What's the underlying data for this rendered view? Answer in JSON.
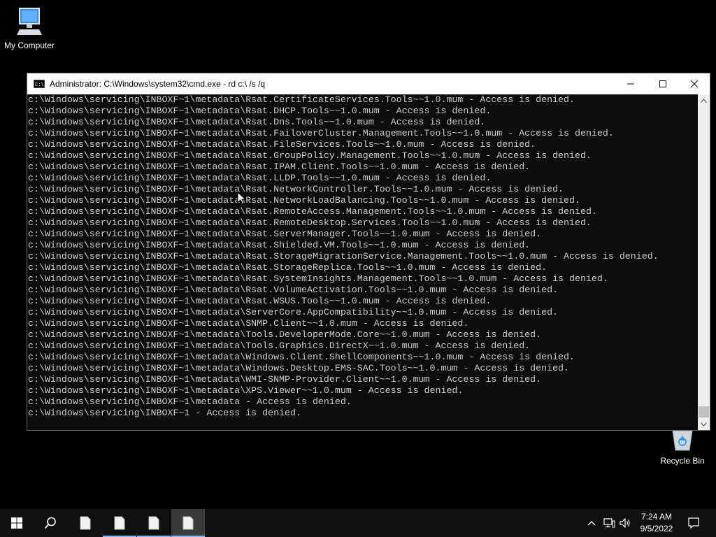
{
  "desktop": {
    "icons": [
      {
        "label": "My Computer",
        "icon": "computer-icon"
      },
      {
        "label": "Recycle Bin",
        "icon": "recycle-bin-icon"
      }
    ]
  },
  "window": {
    "title": "Administrator: C:\\Windows\\system32\\cmd.exe - rd  c:\\ /s /q",
    "app_icon": "cmd-icon",
    "controls": [
      "minimize-icon",
      "maximize-icon",
      "close-icon"
    ]
  },
  "console": {
    "lines": [
      "c:\\Windows\\servicing\\INBOXF~1\\metadata\\Rsat.CertificateServices.Tools~~1.0.mum - Access is denied.",
      "c:\\Windows\\servicing\\INBOXF~1\\metadata\\Rsat.DHCP.Tools~~1.0.mum - Access is denied.",
      "c:\\Windows\\servicing\\INBOXF~1\\metadata\\Rsat.Dns.Tools~~1.0.mum - Access is denied.",
      "c:\\Windows\\servicing\\INBOXF~1\\metadata\\Rsat.FailoverCluster.Management.Tools~~1.0.mum - Access is denied.",
      "c:\\Windows\\servicing\\INBOXF~1\\metadata\\Rsat.FileServices.Tools~~1.0.mum - Access is denied.",
      "c:\\Windows\\servicing\\INBOXF~1\\metadata\\Rsat.GroupPolicy.Management.Tools~~1.0.mum - Access is denied.",
      "c:\\Windows\\servicing\\INBOXF~1\\metadata\\Rsat.IPAM.Client.Tools~~1.0.mum - Access is denied.",
      "c:\\Windows\\servicing\\INBOXF~1\\metadata\\Rsat.LLDP.Tools~~1.0.mum - Access is denied.",
      "c:\\Windows\\servicing\\INBOXF~1\\metadata\\Rsat.NetworkController.Tools~~1.0.mum - Access is denied.",
      "c:\\Windows\\servicing\\INBOXF~1\\metadata\\Rsat.NetworkLoadBalancing.Tools~~1.0.mum - Access is denied.",
      "c:\\Windows\\servicing\\INBOXF~1\\metadata\\Rsat.RemoteAccess.Management.Tools~~1.0.mum - Access is denied.",
      "c:\\Windows\\servicing\\INBOXF~1\\metadata\\Rsat.RemoteDesktop.Services.Tools~~1.0.mum - Access is denied.",
      "c:\\Windows\\servicing\\INBOXF~1\\metadata\\Rsat.ServerManager.Tools~~1.0.mum - Access is denied.",
      "c:\\Windows\\servicing\\INBOXF~1\\metadata\\Rsat.Shielded.VM.Tools~~1.0.mum - Access is denied.",
      "c:\\Windows\\servicing\\INBOXF~1\\metadata\\Rsat.StorageMigrationService.Management.Tools~~1.0.mum - Access is denied.",
      "c:\\Windows\\servicing\\INBOXF~1\\metadata\\Rsat.StorageReplica.Tools~~1.0.mum - Access is denied.",
      "c:\\Windows\\servicing\\INBOXF~1\\metadata\\Rsat.SystemInsights.Management.Tools~~1.0.mum - Access is denied.",
      "c:\\Windows\\servicing\\INBOXF~1\\metadata\\Rsat.VolumeActivation.Tools~~1.0.mum - Access is denied.",
      "c:\\Windows\\servicing\\INBOXF~1\\metadata\\Rsat.WSUS.Tools~~1.0.mum - Access is denied.",
      "c:\\Windows\\servicing\\INBOXF~1\\metadata\\ServerCore.AppCompatibility~~1.0.mum - Access is denied.",
      "c:\\Windows\\servicing\\INBOXF~1\\metadata\\SNMP.Client~~1.0.mum - Access is denied.",
      "c:\\Windows\\servicing\\INBOXF~1\\metadata\\Tools.DeveloperMode.Core~~1.0.mum - Access is denied.",
      "c:\\Windows\\servicing\\INBOXF~1\\metadata\\Tools.Graphics.DirectX~~1.0.mum - Access is denied.",
      "c:\\Windows\\servicing\\INBOXF~1\\metadata\\Windows.Client.ShellComponents~~1.0.mum - Access is denied.",
      "c:\\Windows\\servicing\\INBOXF~1\\metadata\\Windows.Desktop.EMS-SAC.Tools~~1.0.mum - Access is denied.",
      "c:\\Windows\\servicing\\INBOXF~1\\metadata\\WMI-SNMP-Provider.Client~~1.0.mum - Access is denied.",
      "c:\\Windows\\servicing\\INBOXF~1\\metadata\\XPS.Viewer~~1.0.mum - Access is denied.",
      "c:\\Windows\\servicing\\INBOXF~1\\metadata - Access is denied.",
      "c:\\Windows\\servicing\\INBOXF~1 - Access is denied."
    ],
    "text_color": "#cccccc",
    "background": "#0c0c0c"
  },
  "taskbar": {
    "start_icon": "windows-start-icon",
    "search_icon": "search-icon",
    "pinned": [
      "document-icon",
      "document-icon",
      "document-icon",
      "document-icon"
    ],
    "tray": [
      "chevron-up-icon",
      "network-icon",
      "volume-icon",
      "notification-icon"
    ],
    "clock": {
      "time": "7:24 AM",
      "date": "9/5/2022"
    },
    "accent": "#8ab4f8"
  }
}
